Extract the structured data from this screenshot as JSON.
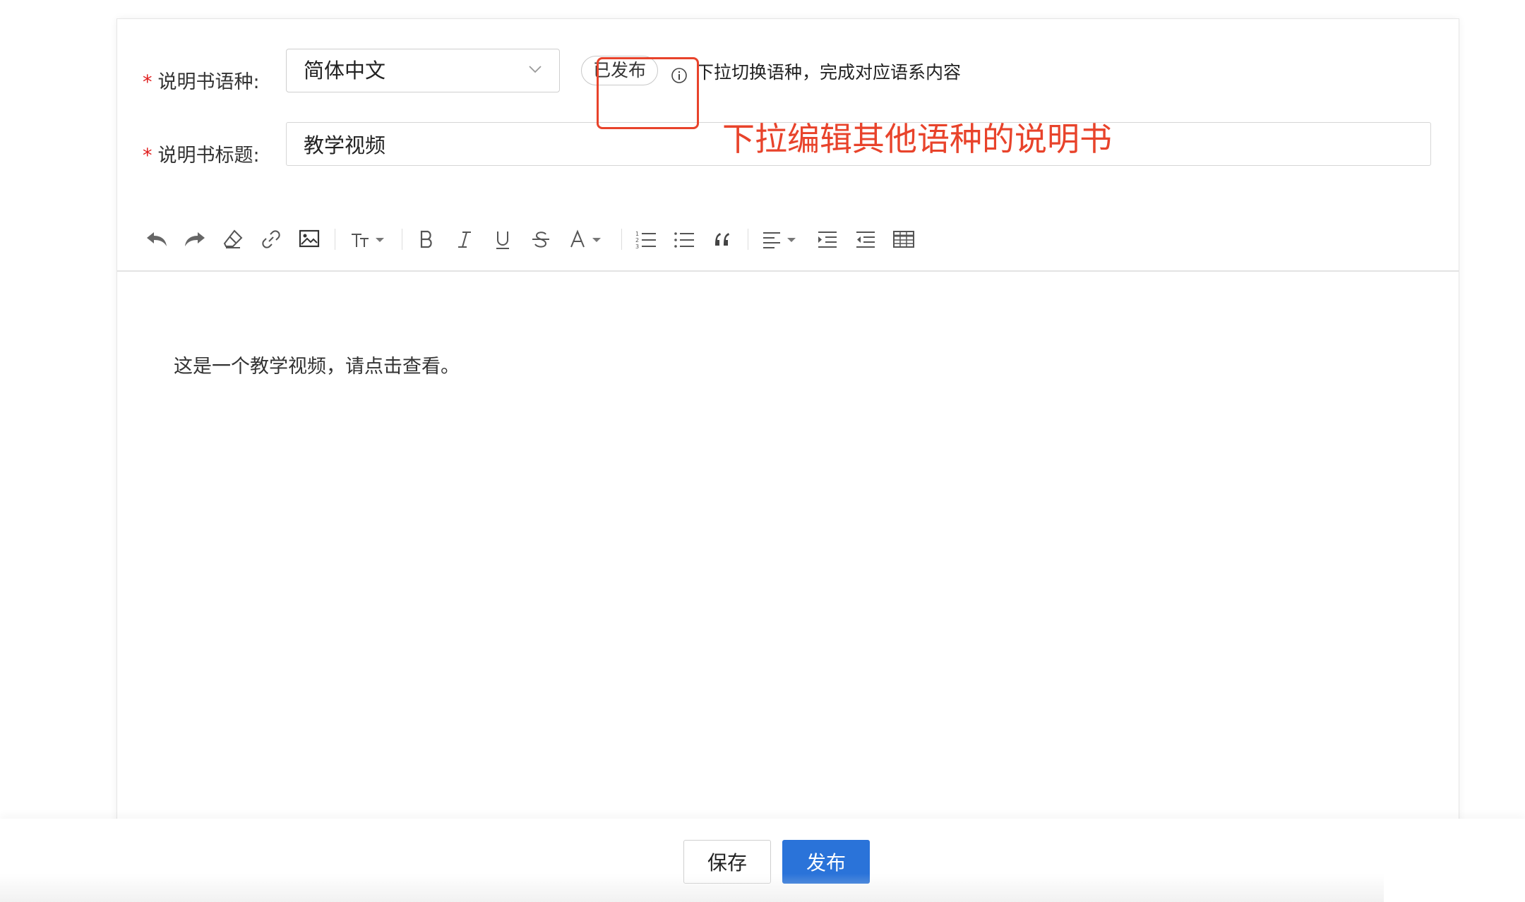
{
  "form": {
    "language_label": "说明书语种:",
    "language_value": "简体中文",
    "status_badge": "已发布",
    "hint_text": "下拉切换语种，完成对应语系内容",
    "title_label": "说明书标题:",
    "title_value": "教学视频",
    "required_mark": "*"
  },
  "toolbar": {
    "icons": [
      "undo-icon",
      "redo-icon",
      "clear-format-icon",
      "link-icon",
      "image-icon",
      "font-size-icon",
      "bold-icon",
      "italic-icon",
      "underline-icon",
      "strikethrough-icon",
      "font-color-icon",
      "ordered-list-icon",
      "unordered-list-icon",
      "blockquote-icon",
      "align-icon",
      "indent-icon",
      "outdent-icon",
      "table-icon"
    ]
  },
  "editor": {
    "content": "这是一个教学视频，请点击查看。"
  },
  "annotation": {
    "text": "下拉编辑其他语种的说明书",
    "color": "#e8432b"
  },
  "footer": {
    "save_label": "保存",
    "publish_label": "发布",
    "publish_color": "#2a73d9"
  }
}
